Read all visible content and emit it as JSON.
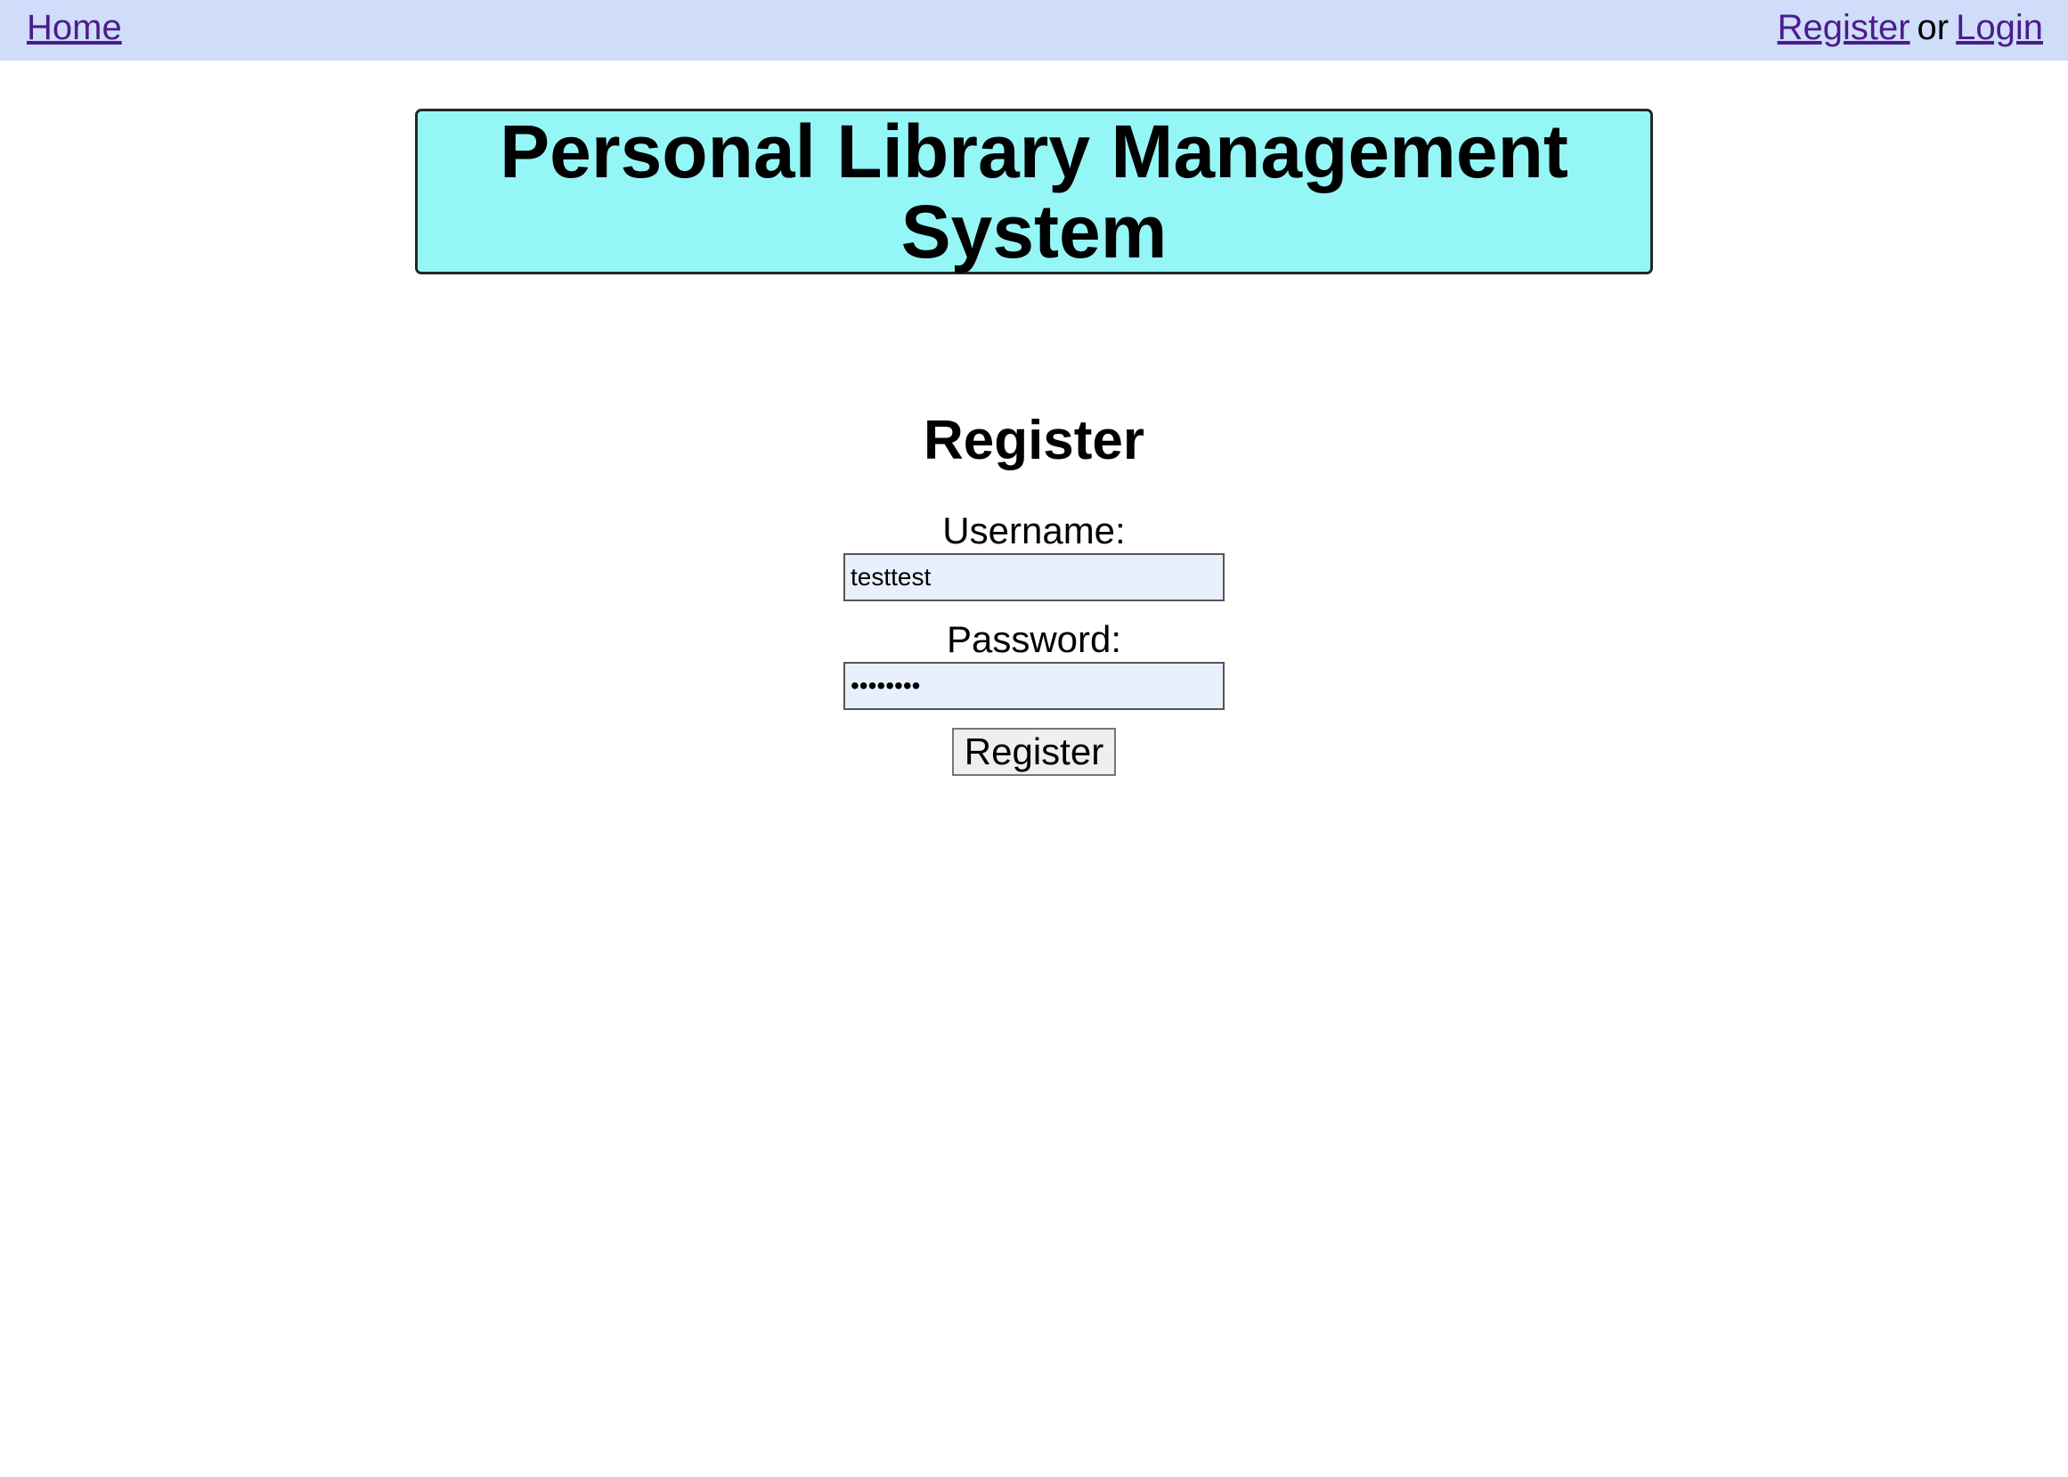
{
  "nav": {
    "home_label": "Home",
    "register_label": "Register",
    "separator": "or",
    "login_label": "Login"
  },
  "banner": {
    "title": "Personal Library Management System"
  },
  "form": {
    "title": "Register",
    "username_label": "Username:",
    "username_value": "testtest",
    "password_label": "Password:",
    "password_value": "testtest",
    "submit_label": "Register"
  },
  "colors": {
    "nav_background": "#cfdcfa",
    "banner_background": "#95f6f6",
    "link": "#4b1d8c",
    "input_background": "#e8f0fe"
  }
}
